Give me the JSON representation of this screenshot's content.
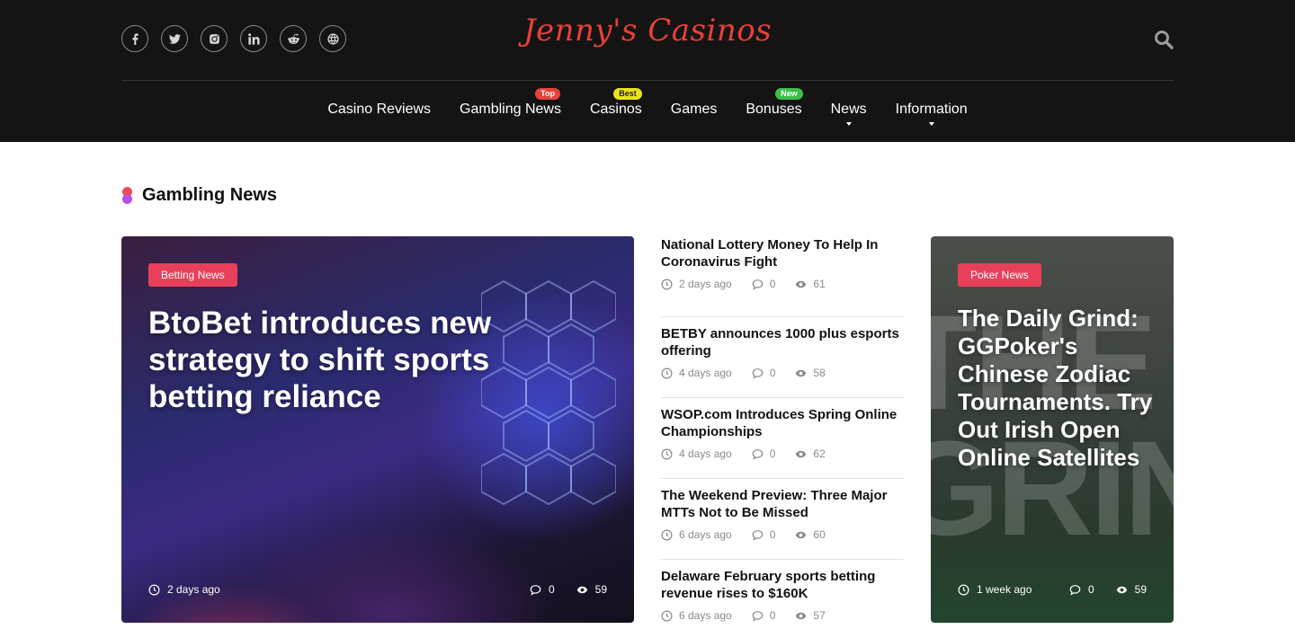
{
  "header": {
    "logo_text": "Jenny's Casinos",
    "socials": [
      {
        "name": "facebook"
      },
      {
        "name": "twitter"
      },
      {
        "name": "instagram"
      },
      {
        "name": "linkedin"
      },
      {
        "name": "reddit"
      },
      {
        "name": "website"
      }
    ],
    "nav": [
      {
        "label": "Casino Reviews",
        "badge": "",
        "has_dropdown": false
      },
      {
        "label": "Gambling News",
        "badge": "Top",
        "has_dropdown": false
      },
      {
        "label": "Casinos",
        "badge": "Best",
        "has_dropdown": false
      },
      {
        "label": "Games",
        "badge": "",
        "has_dropdown": false
      },
      {
        "label": "Bonuses",
        "badge": "New",
        "has_dropdown": false
      },
      {
        "label": "News",
        "badge": "",
        "has_dropdown": true
      },
      {
        "label": "Information",
        "badge": "",
        "has_dropdown": true
      }
    ]
  },
  "section": {
    "title": "Gambling News"
  },
  "feature": {
    "category": "Betting News",
    "title": "BtoBet introduces new strategy to shift sports betting reliance",
    "time": "2 days ago",
    "comments": "0",
    "views": "59"
  },
  "list": [
    {
      "title": "National Lottery Money To Help In Coronavirus Fight",
      "time": "2 days ago",
      "comments": "0",
      "views": "61"
    },
    {
      "title": "BETBY announces 1000 plus esports offering",
      "time": "4 days ago",
      "comments": "0",
      "views": "58"
    },
    {
      "title": "WSOP.com Introduces Spring Online Championships",
      "time": "4 days ago",
      "comments": "0",
      "views": "62"
    },
    {
      "title": "The Weekend Preview: Three Major MTTs Not to Be Missed",
      "time": "6 days ago",
      "comments": "0",
      "views": "60"
    },
    {
      "title": "Delaware February sports betting revenue rises to $160K",
      "time": "6 days ago",
      "comments": "0",
      "views": "57"
    }
  ],
  "side_card": {
    "category": "Poker News",
    "title": "The Daily Grind: GGPoker's Chinese Zodiac Tournaments. Try Out Irish Open Online Satellites",
    "time": "1 week ago",
    "comments": "0",
    "views": "59"
  },
  "colors": {
    "header_bg": "#141414",
    "logo": "#e8403a",
    "pill": "#e8405a",
    "badge_top": "#e8403a",
    "badge_best": "#e9e31d",
    "badge_new": "#3bbf4a"
  }
}
